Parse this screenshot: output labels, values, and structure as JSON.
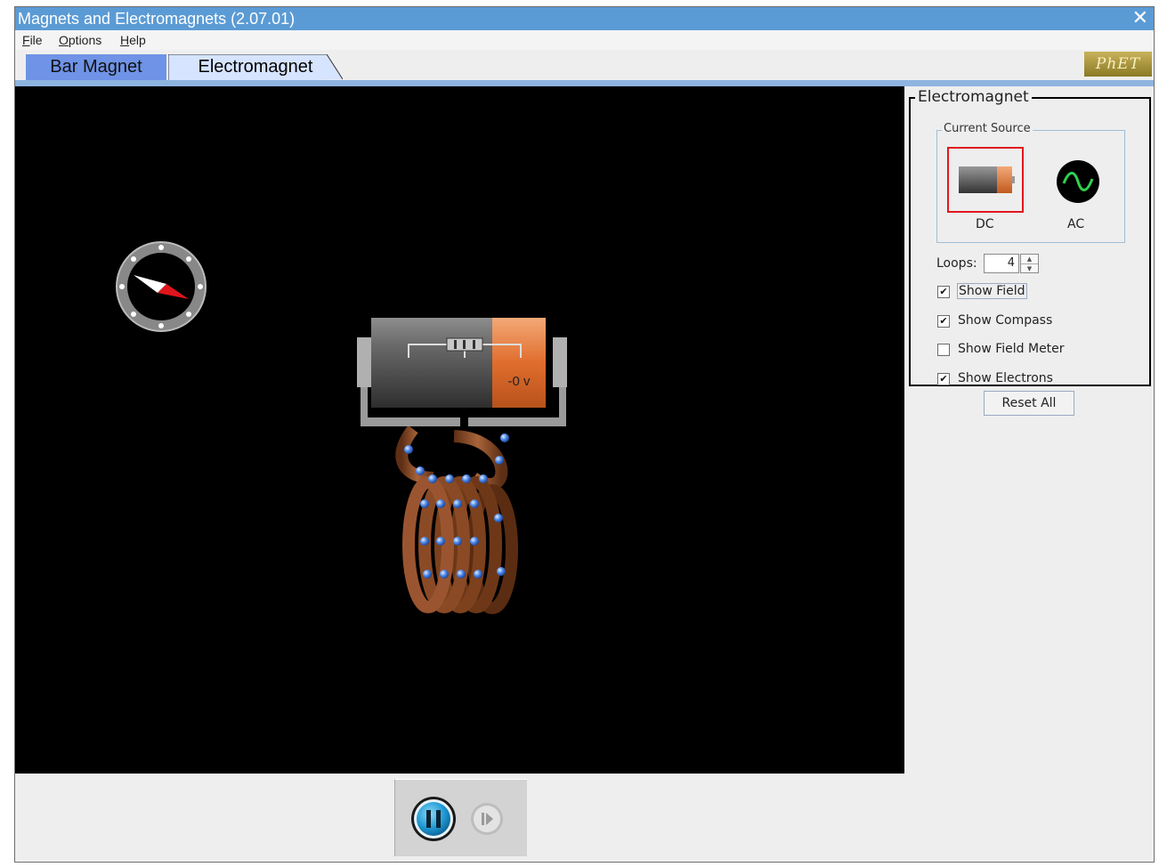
{
  "window": {
    "title": "Magnets and Electromagnets (2.07.01)",
    "close_glyph": "✕"
  },
  "menu": {
    "file": {
      "mnemonic": "F",
      "rest": "ile"
    },
    "options": {
      "mnemonic": "O",
      "rest": "ptions"
    },
    "help": {
      "mnemonic": "H",
      "rest": "elp"
    }
  },
  "tabs": [
    {
      "label": "Bar Magnet",
      "selected": false
    },
    {
      "label": "Electromagnet",
      "selected": true
    }
  ],
  "logo": "PhET",
  "simulation": {
    "voltmeter_reading": "-0 v",
    "compass_icon": "compass-icon",
    "battery_icon": "battery-icon",
    "coil_icon": "coil-icon",
    "loop_count": 4,
    "background_color": "#000000"
  },
  "control_panel": {
    "title": "Electromagnet",
    "current_source": {
      "title": "Current Source",
      "options": [
        {
          "label": "DC",
          "icon": "battery-icon",
          "selected": true
        },
        {
          "label": "AC",
          "icon": "ac-sine-icon",
          "selected": false
        }
      ],
      "selected_color": "#e1171e"
    },
    "loops": {
      "label": "Loops:",
      "value": "4"
    },
    "checkboxes": [
      {
        "label": "Show Field",
        "checked": true,
        "focused": true
      },
      {
        "label": "Show Compass",
        "checked": true,
        "focused": false
      },
      {
        "label": "Show Field Meter",
        "checked": false,
        "focused": false
      },
      {
        "label": "Show Electrons",
        "checked": true,
        "focused": false
      }
    ],
    "reset_label": "Reset All"
  },
  "clock_controls": {
    "pause_icon": "pause-icon",
    "step_icon": "step-icon",
    "state": "running"
  },
  "colors": {
    "title_bar": "#5b9bd5",
    "tab_active_bg": "#6f93e6",
    "tab_selected_bg": "#d6e4ff",
    "electron": "#4a86e8",
    "wire": "#8b4a26",
    "battery_cap": "#e07a3b"
  }
}
